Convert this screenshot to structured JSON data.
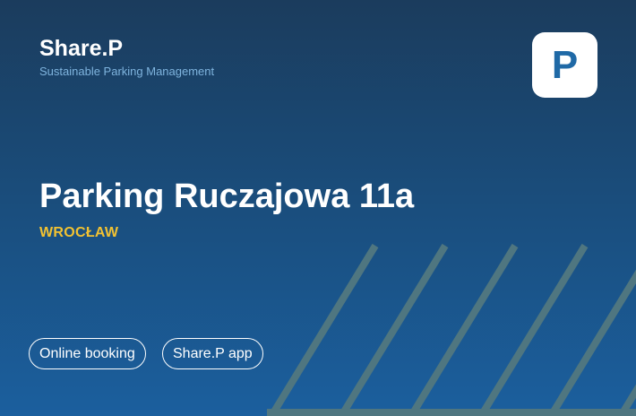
{
  "brand": {
    "name": "Share.P",
    "tagline": "Sustainable Parking Management"
  },
  "logo": {
    "letter": "P",
    "icon": "parking-p-icon"
  },
  "parking": {
    "title": "Parking Ruczajowa 11a",
    "city": "WROCŁAW"
  },
  "links": [
    {
      "label": "Online booking"
    },
    {
      "label": "Share.P app"
    }
  ],
  "colors": {
    "background_top": "#1b3c5d",
    "background_bottom": "#1b5f9e",
    "accent_yellow": "#f2c232",
    "tagline_blue": "#7fb4de",
    "stripe_gray": "#4f7680",
    "logo_blue": "#1f69a6"
  }
}
